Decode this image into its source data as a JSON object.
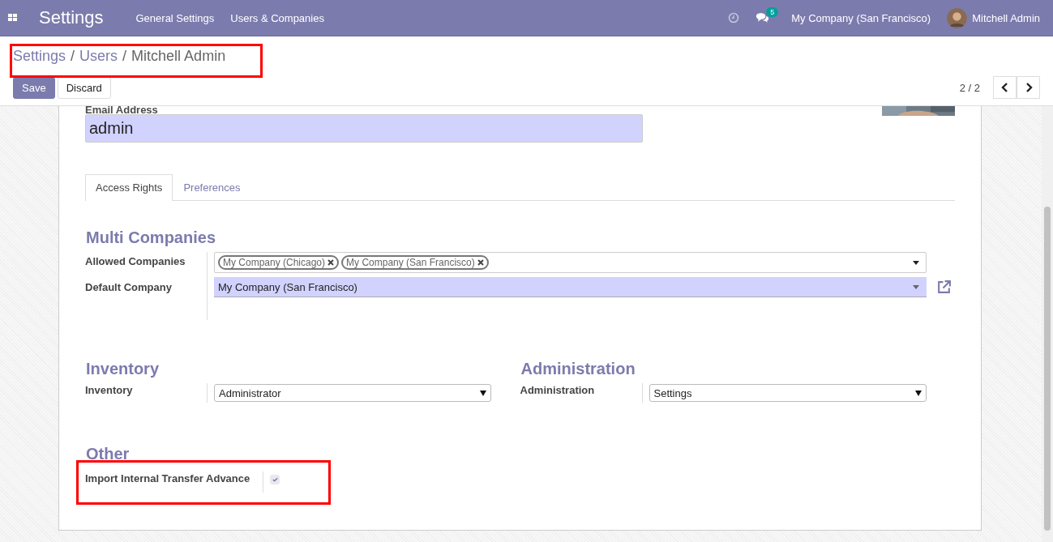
{
  "navbar": {
    "app_title": "Settings",
    "menu": [
      "General Settings",
      "Users & Companies"
    ],
    "messages_badge": "5",
    "company": "My Company (San Francisco)",
    "user": "Mitchell Admin"
  },
  "breadcrumb": [
    {
      "kind": "link",
      "label": "Settings"
    },
    {
      "kind": "separator",
      "label": "/"
    },
    {
      "kind": "link",
      "label": "Users"
    },
    {
      "kind": "separator",
      "label": "/"
    },
    {
      "kind": "current",
      "label": "Mitchell Admin"
    }
  ],
  "buttons": [
    "Save",
    "Discard"
  ],
  "pager": "2 / 2",
  "email": {
    "label": "Email Address",
    "value": "admin"
  },
  "tabs": [
    {
      "label": "Access Rights",
      "selected": true
    },
    {
      "label": "Preferences",
      "selected": false
    }
  ],
  "multi_companies": {
    "title": "Multi Companies",
    "allowed_label": "Allowed Companies",
    "allowed": [
      "My Company (Chicago)",
      "My Company (San Francisco)"
    ],
    "default_label": "Default Company",
    "default": "My Company (San Francisco)"
  },
  "groups": [
    {
      "title": "Inventory",
      "label": "Inventory",
      "value": "Administrator"
    },
    {
      "title": "Administration",
      "label": "Administration",
      "value": "Settings"
    }
  ],
  "other": {
    "title": "Other",
    "label": "Import Internal Transfer Advance",
    "checked": true
  }
}
